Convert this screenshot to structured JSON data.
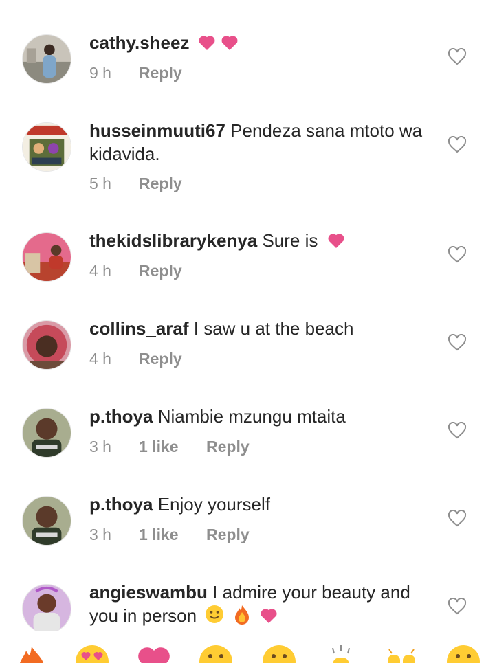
{
  "comments": [
    {
      "user": "cathy.sheez",
      "text": "",
      "time": "9 h",
      "likes": "",
      "reply": "Reply"
    },
    {
      "user": "husseinmuuti67",
      "text": "Pendeza sana mtoto wa kidavida.",
      "time": "5 h",
      "likes": "",
      "reply": "Reply"
    },
    {
      "user": "thekidslibrarykenya",
      "text": "Sure is",
      "time": "4 h",
      "likes": "",
      "reply": "Reply"
    },
    {
      "user": "collins_araf",
      "text": "I saw u at the beach",
      "time": "4 h",
      "likes": "",
      "reply": "Reply"
    },
    {
      "user": "p.thoya",
      "text": "Niambie mzungu mtaita",
      "time": "3 h",
      "likes": "1 like",
      "reply": "Reply"
    },
    {
      "user": "p.thoya",
      "text": "Enjoy yourself",
      "time": "3 h",
      "likes": "1 like",
      "reply": "Reply"
    },
    {
      "user": "angieswambu",
      "text": "I admire your beauty and you in person",
      "time": "",
      "likes": "",
      "reply": ""
    }
  ],
  "emoji_bar": [
    "fire-emoji",
    "heart-eyes-emoji",
    "heart-emoji",
    "grin-emoji",
    "grimace-emoji",
    "clap-emoji",
    "raising-hands-emoji",
    "smile-emoji"
  ],
  "colors": {
    "accent_heart": "#e8508a",
    "meta_text": "#8e8e8e",
    "username": "#262626"
  }
}
